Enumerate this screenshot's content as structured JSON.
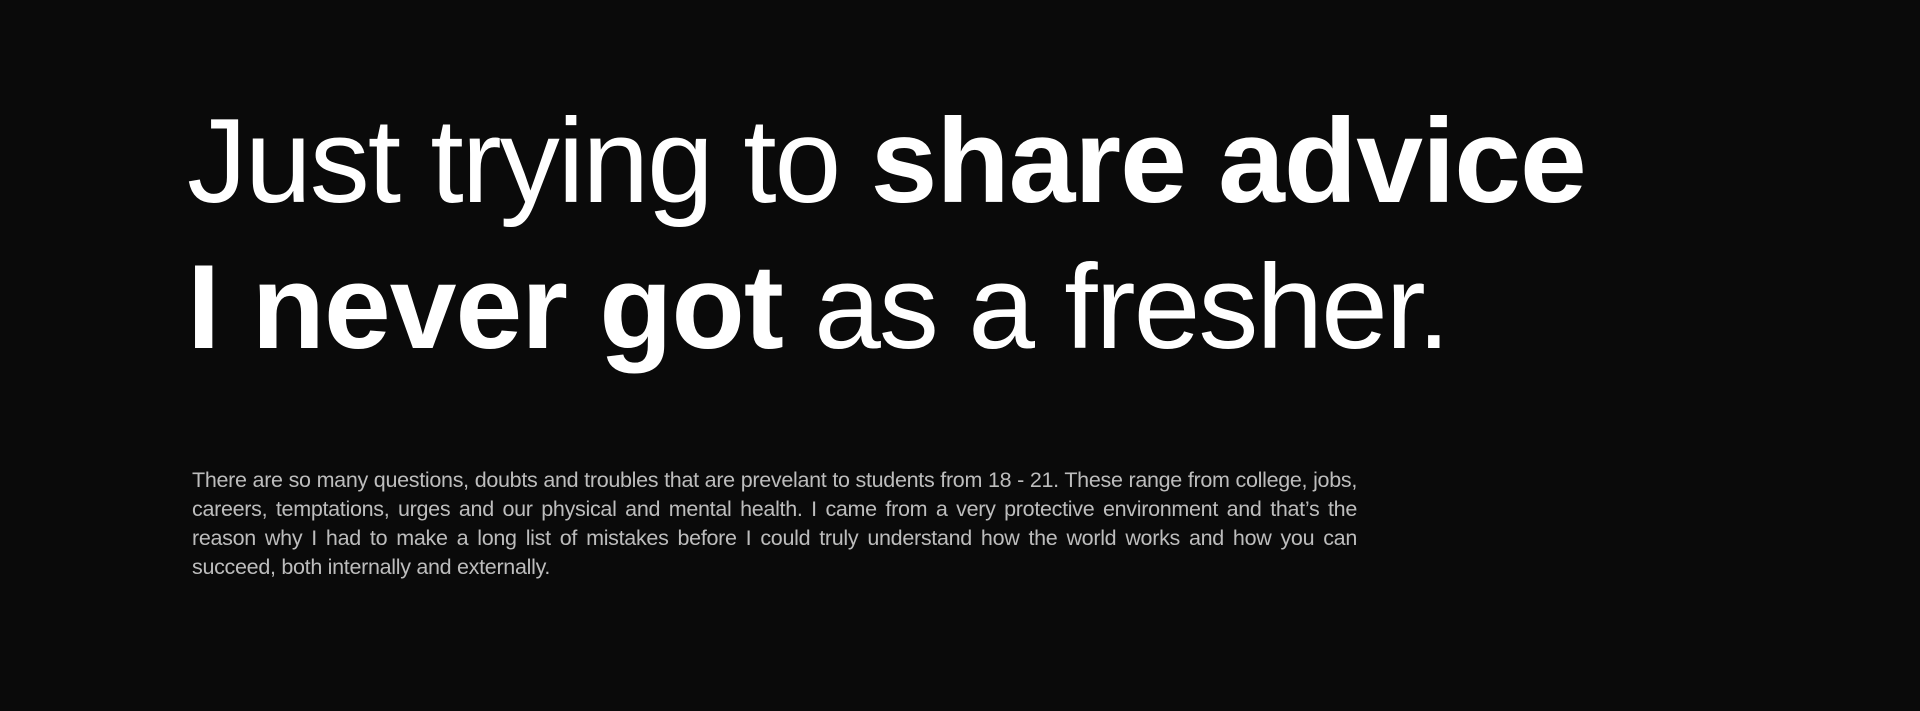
{
  "hero": {
    "line1": {
      "regular": "Just trying to ",
      "bold": "share advice"
    },
    "line2": {
      "bold": "I never got",
      "regular": " as a fresher."
    }
  },
  "description": "There are so many questions, doubts and troubles that are prevelant to students from 18 - 21. These range from college, jobs, careers, temptations, urges and our physical and mental health. I came from a very protective environment and that’s the reason why I had to make a long list of mistakes before I could truly understand how the world works and how you can succeed, both internally and externally.",
  "colors": {
    "background": "#0a0a0a",
    "headline": "#ffffff",
    "body_text": "#bdbdbd"
  }
}
